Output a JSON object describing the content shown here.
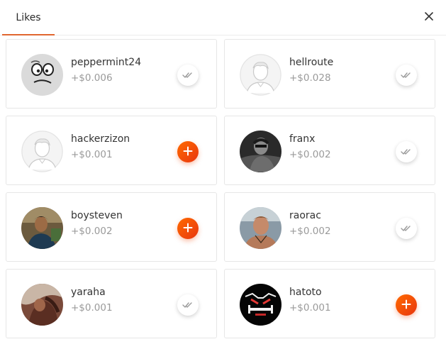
{
  "header": {
    "tab_label": "Likes",
    "close_icon": "close-icon"
  },
  "colors": {
    "accent": "#e0662f",
    "add_button": "#f4511e",
    "amount_text": "#9a9a9a"
  },
  "users": [
    {
      "name": "peppermint24",
      "amount": "+$0.006",
      "status": "liked",
      "action_icon": "double-check-icon"
    },
    {
      "name": "hellroute",
      "amount": "+$0.028",
      "status": "liked",
      "action_icon": "double-check-icon"
    },
    {
      "name": "hackerzizon",
      "amount": "+$0.001",
      "status": "add",
      "action_icon": "plus-icon"
    },
    {
      "name": "franx",
      "amount": "+$0.002",
      "status": "liked",
      "action_icon": "double-check-icon"
    },
    {
      "name": "boysteven",
      "amount": "+$0.002",
      "status": "add",
      "action_icon": "plus-icon"
    },
    {
      "name": "raorac",
      "amount": "+$0.002",
      "status": "liked",
      "action_icon": "double-check-icon"
    },
    {
      "name": "yaraha",
      "amount": "+$0.001",
      "status": "liked",
      "action_icon": "double-check-icon"
    },
    {
      "name": "hatoto",
      "amount": "+$0.001",
      "status": "add",
      "action_icon": "plus-icon"
    }
  ]
}
